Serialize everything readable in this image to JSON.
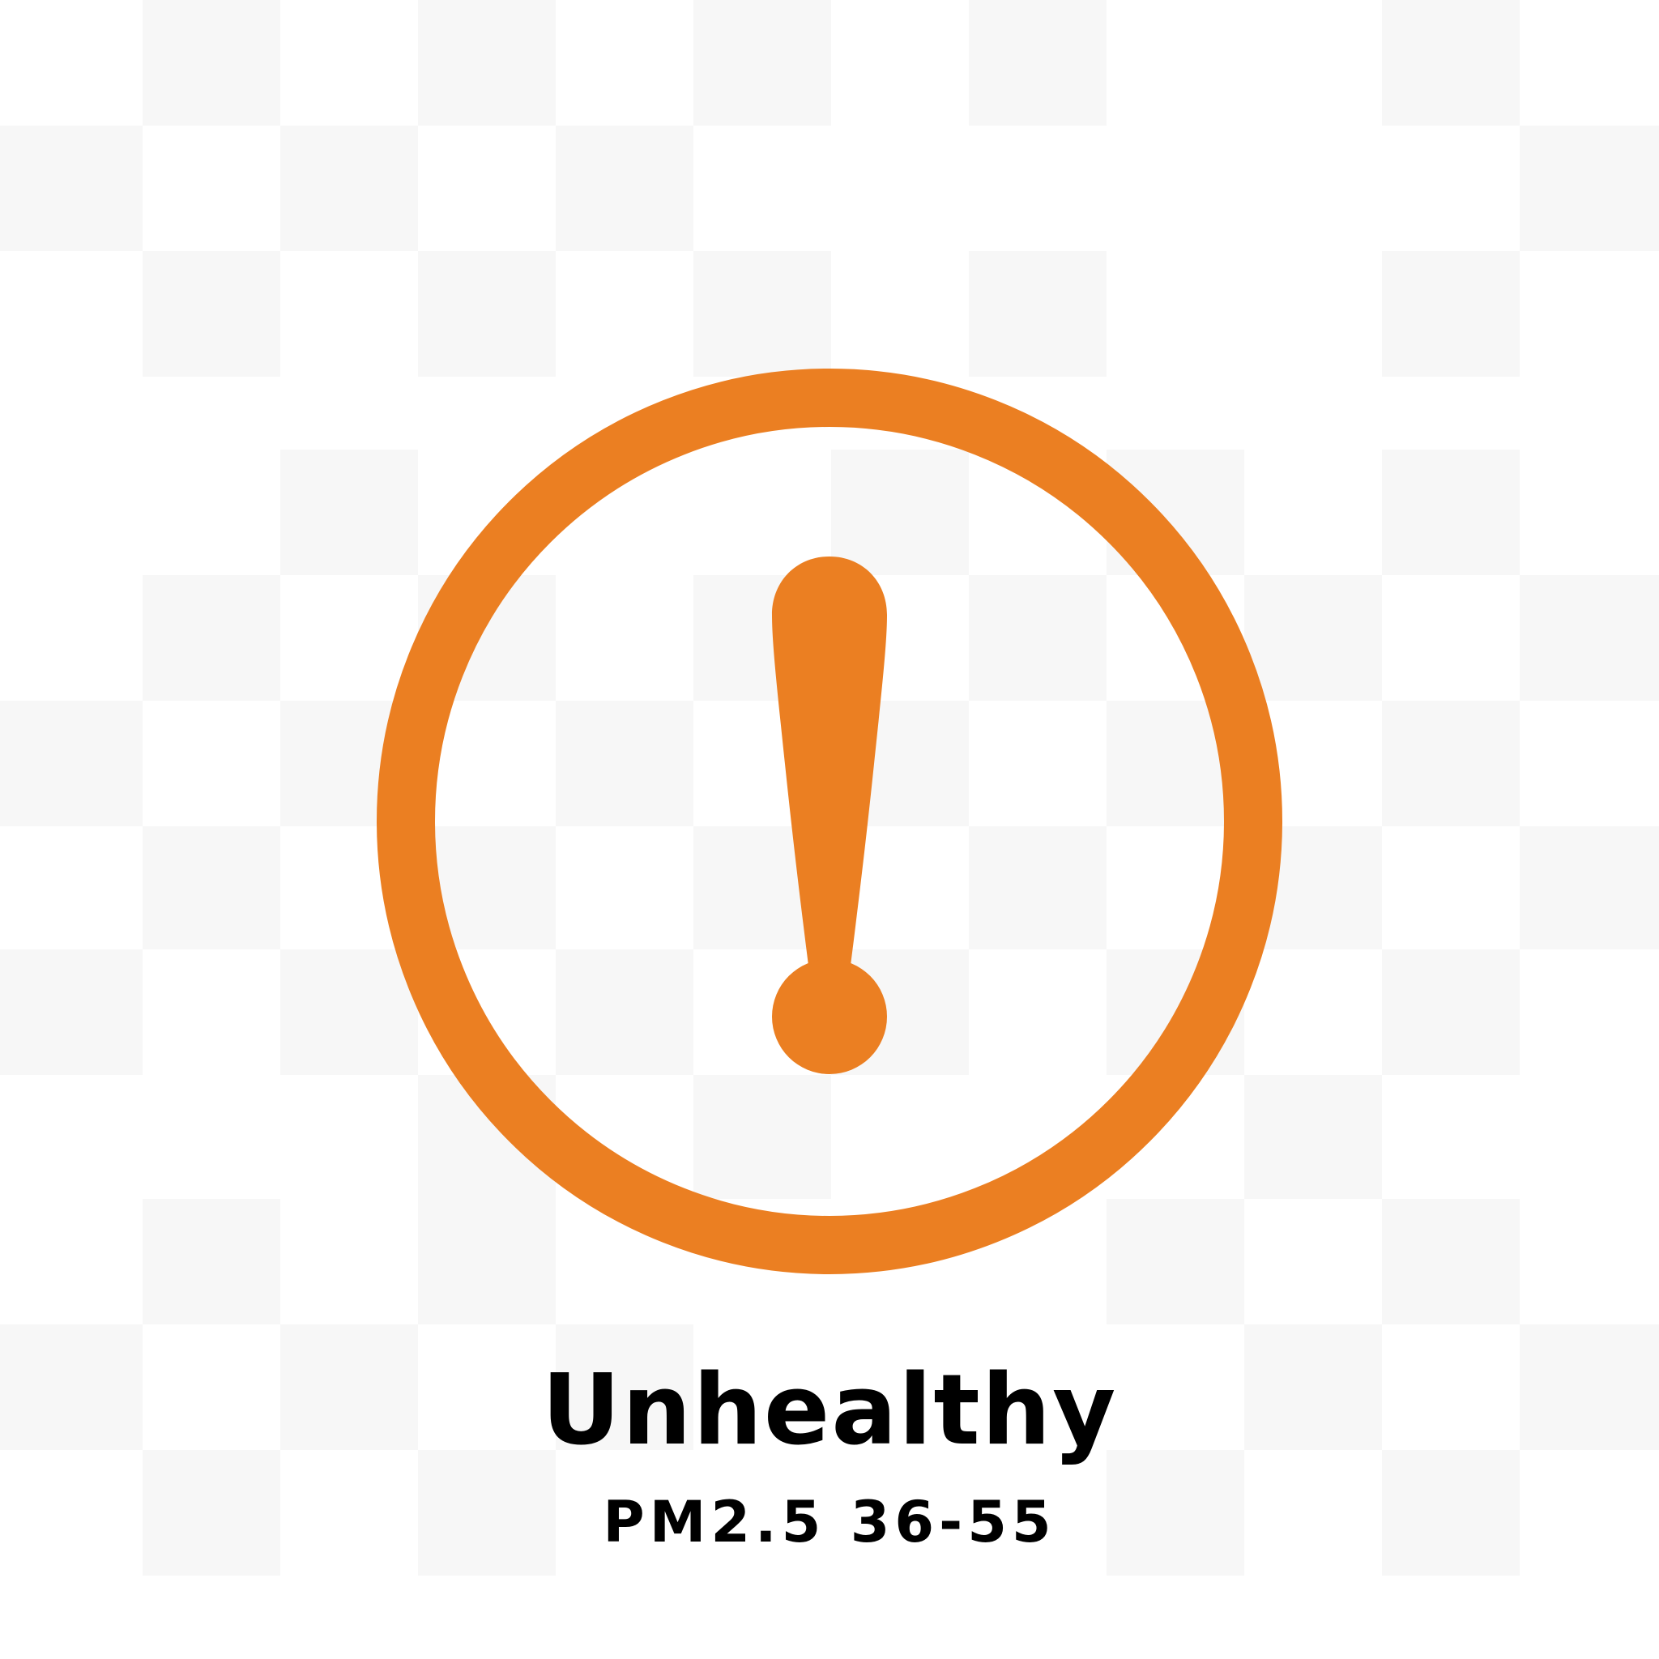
{
  "status": {
    "label": "Unhealthy",
    "range": "PM2.5 36-55"
  },
  "icon": {
    "name": "exclamation-circle-icon",
    "color": "#EB7F22"
  },
  "background": {
    "pattern": "checkerboard",
    "colors": [
      "#ffffff",
      "#f7f7f7"
    ]
  }
}
